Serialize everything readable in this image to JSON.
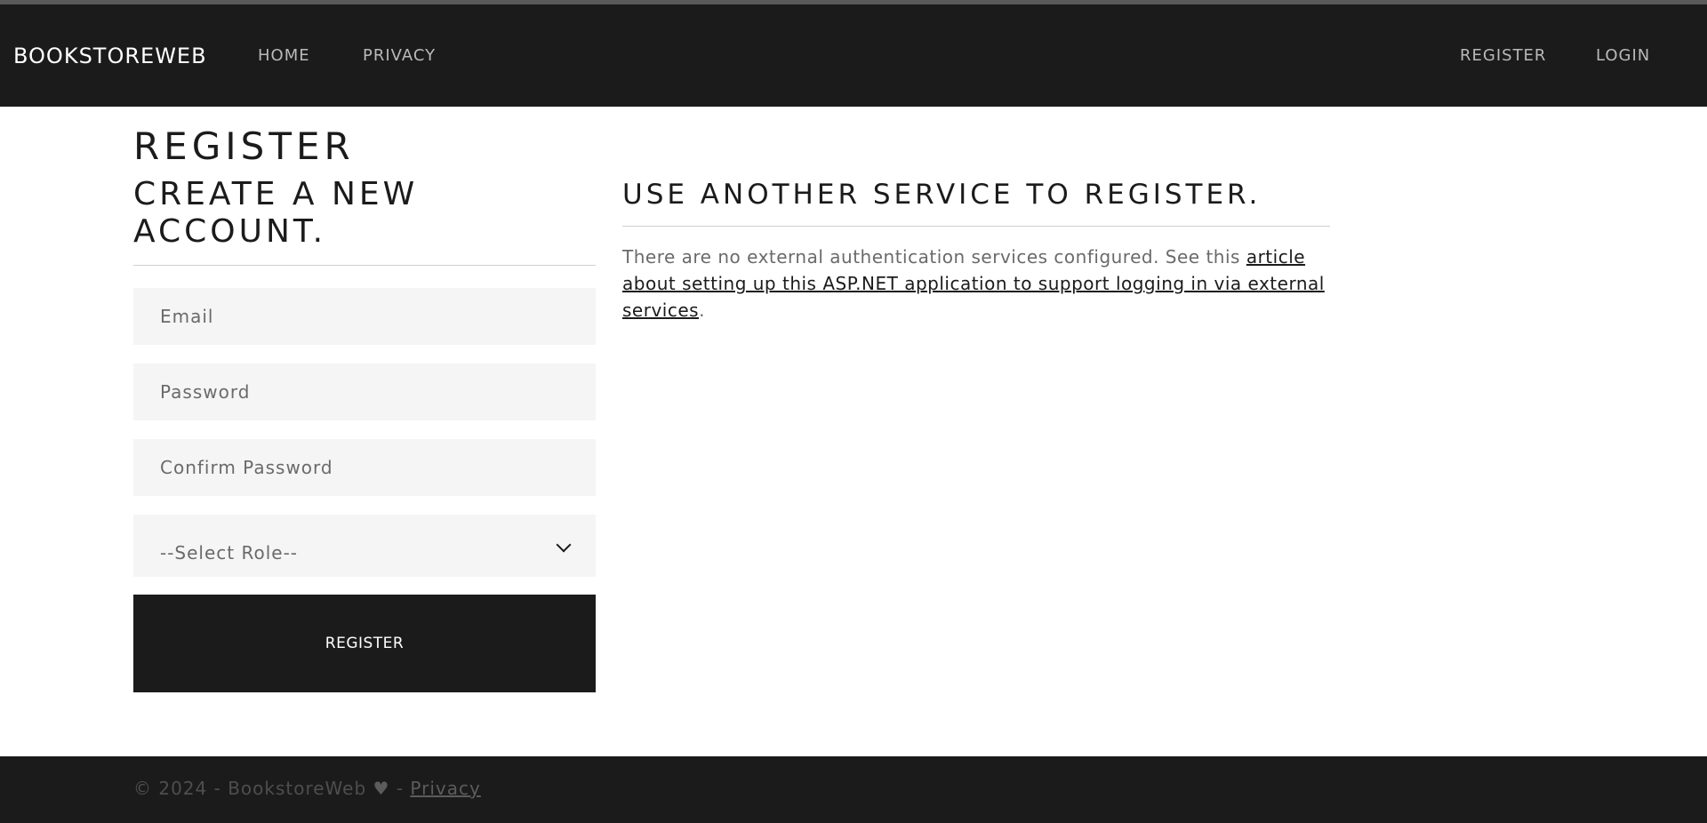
{
  "navbar": {
    "brand": "BOOKSTOREWEB",
    "links": [
      "HOME",
      "PRIVACY"
    ],
    "auth_links": [
      "REGISTER",
      "LOGIN"
    ]
  },
  "page": {
    "title": "REGISTER",
    "subtitle": "CREATE A NEW ACCOUNT."
  },
  "form": {
    "email_placeholder": "Email",
    "password_placeholder": "Password",
    "confirm_placeholder": "Confirm Password",
    "role_selected": "--Select Role--",
    "submit_label": "REGISTER"
  },
  "external": {
    "title": "USE ANOTHER SERVICE TO REGISTER.",
    "text_prefix": "There are no external authentication services configured. See this ",
    "link_text": "article about setting up this ASP.NET application to support logging in via external services",
    "text_suffix": "."
  },
  "footer": {
    "text": "© 2024 - BookstoreWeb",
    "heart_icon": "heart-icon",
    "separator": "-",
    "privacy_link": "Privacy"
  },
  "colors": {
    "nav_bg": "#1b1b1b",
    "field_bg": "#f5f5f6",
    "button_bg": "#1b1b1b",
    "text_dark": "#1b1b1b",
    "text_muted": "#6a6a6a"
  }
}
